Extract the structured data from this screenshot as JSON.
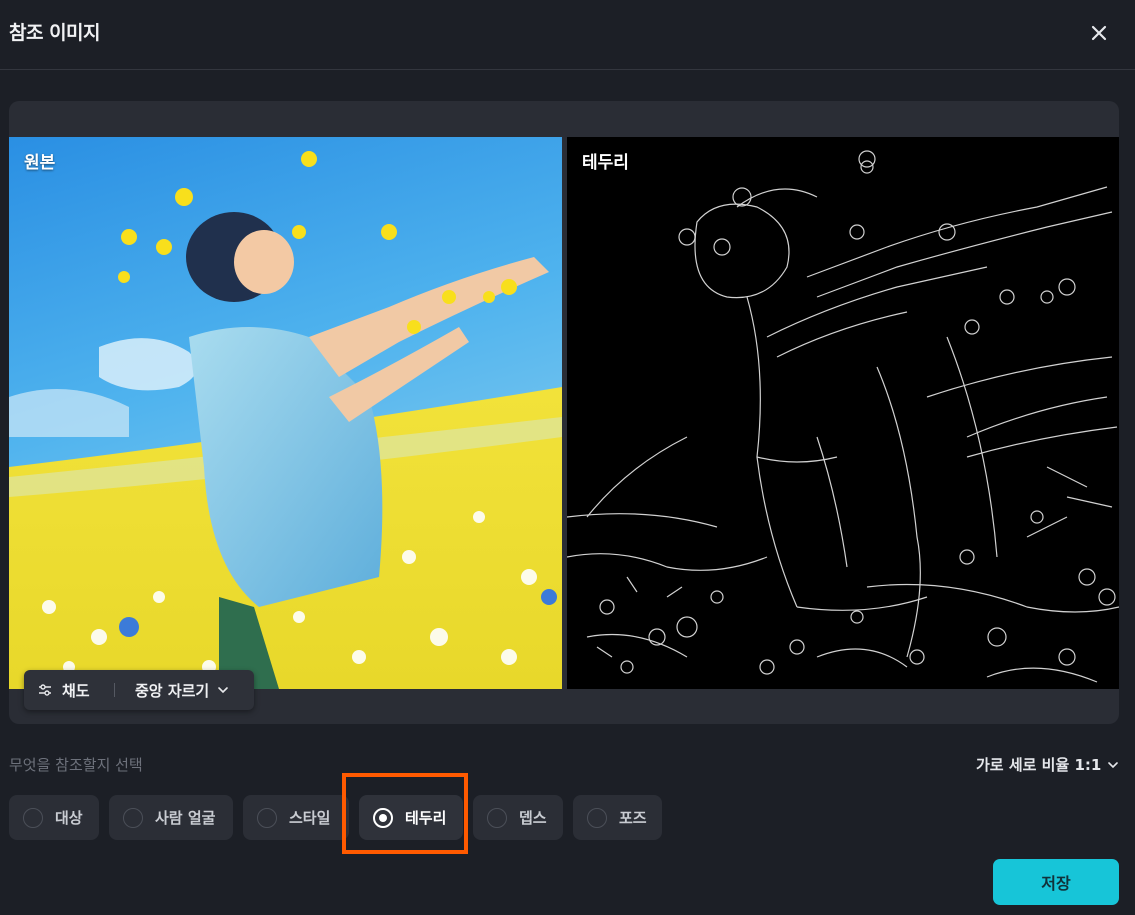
{
  "header": {
    "title": "참조 이미지",
    "close_icon": "close-icon"
  },
  "preview": {
    "original_label": "원본",
    "processed_label": "테두리"
  },
  "toolbar": {
    "saturation_label": "채도",
    "crop_label": "중앙 자르기",
    "saturation_icon": "sliders-icon",
    "crop_icon": "chevron-down-icon"
  },
  "reference": {
    "section_label": "무엇을 참조할지 선택",
    "ratio_label": "가로 세로 비율 1:1",
    "options": [
      {
        "label": "대상",
        "selected": false
      },
      {
        "label": "사람 얼굴",
        "selected": false
      },
      {
        "label": "스타일",
        "selected": false
      },
      {
        "label": "테두리",
        "selected": true
      },
      {
        "label": "뎁스",
        "selected": false
      },
      {
        "label": "포즈",
        "selected": false
      }
    ]
  },
  "footer": {
    "save_label": "저장"
  },
  "colors": {
    "background": "#1c1f26",
    "panel": "#2a2d35",
    "accent": "#17c5d8",
    "highlight": "#ff5a00"
  }
}
